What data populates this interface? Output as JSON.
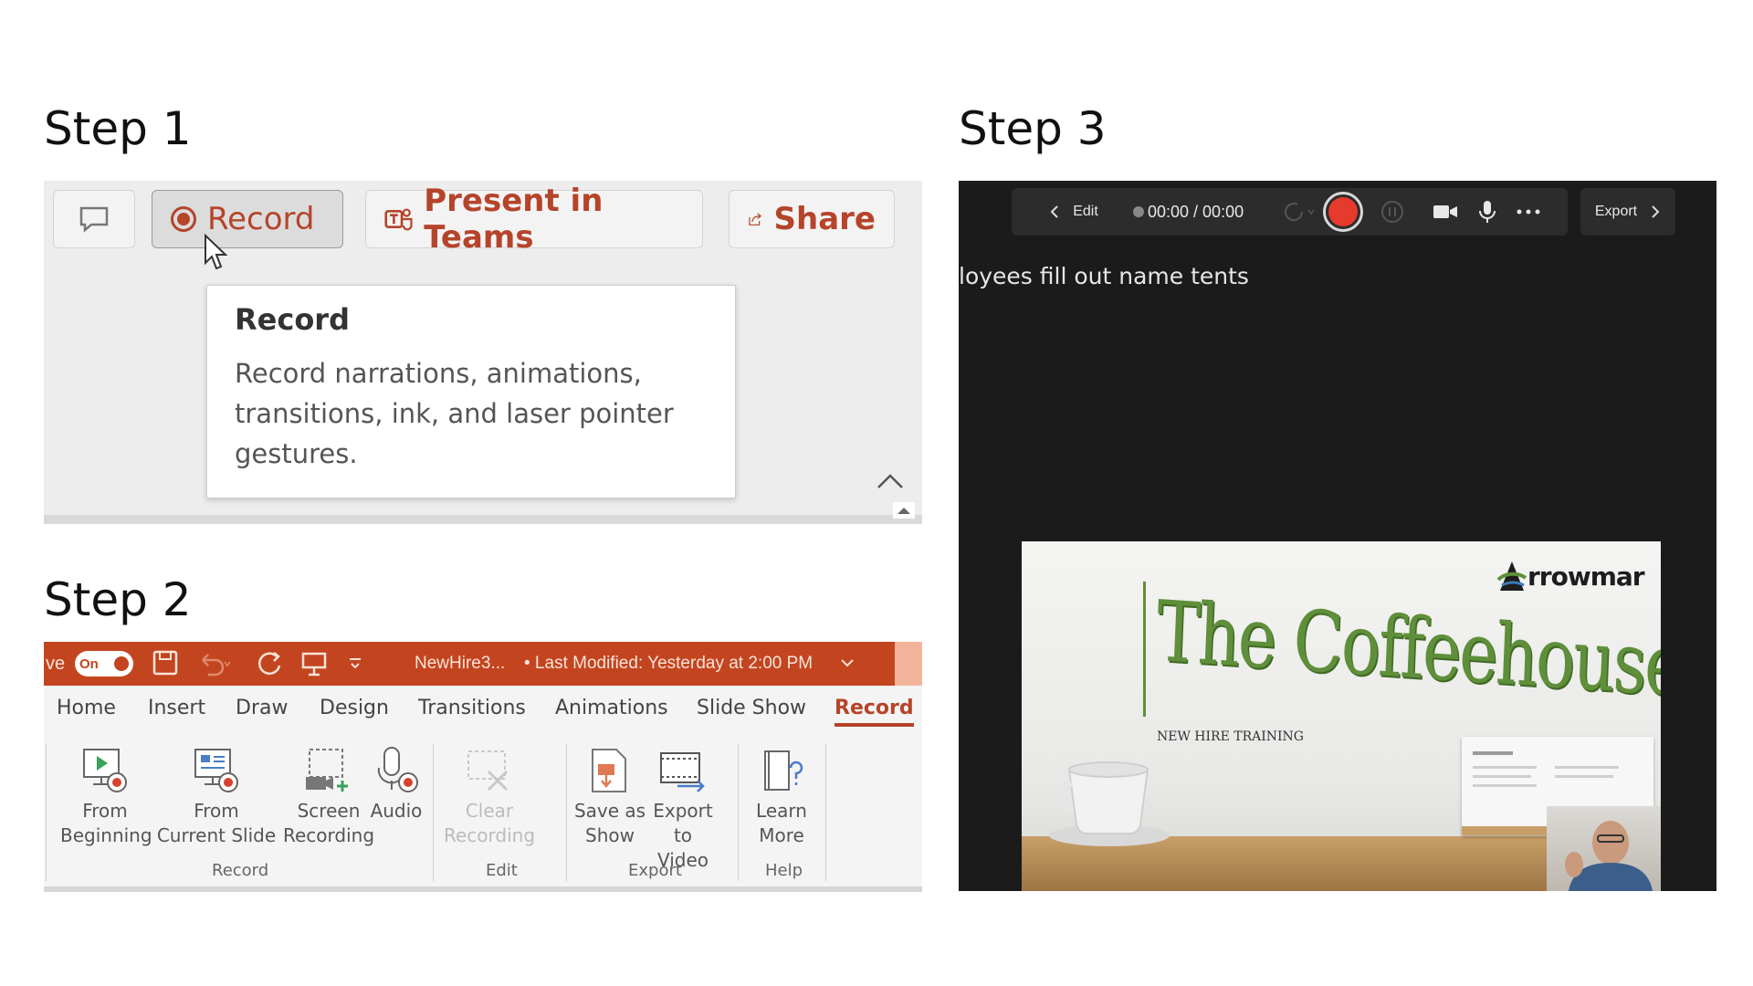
{
  "steps": {
    "step1": "Step 1",
    "step2": "Step 2",
    "step3": "Step 3"
  },
  "panel1": {
    "buttons": {
      "record": "Record",
      "present": "Present in Teams",
      "share": "Share"
    },
    "tooltip": {
      "title": "Record",
      "text": "Record narrations, animations, transitions, ink, and laser pointer gestures."
    }
  },
  "panel2": {
    "titlebar": {
      "autosave_fragment": "ve",
      "toggle": "On",
      "filename": "NewHire3...",
      "modified": "• Last Modified: Yesterday at 2:00 PM"
    },
    "tabs": [
      "Home",
      "Insert",
      "Draw",
      "Design",
      "Transitions",
      "Animations",
      "Slide Show",
      "Record"
    ],
    "buttons": {
      "from_beginning_1": "From",
      "from_beginning_2": "Beginning",
      "from_current_1": "From",
      "from_current_2": "Current Slide",
      "screen_rec_1": "Screen",
      "screen_rec_2": "Recording",
      "audio": "Audio",
      "clear_1": "Clear",
      "clear_2": "Recording",
      "save_show_1": "Save as",
      "save_show_2": "Show",
      "export_video_1": "Export",
      "export_video_2": "to Video",
      "learn_1": "Learn",
      "learn_2": "More"
    },
    "groups": {
      "record": "Record",
      "edit": "Edit",
      "export": "Export",
      "help": "Help"
    }
  },
  "panel3": {
    "edit": "Edit",
    "time": "00:00 / 00:00",
    "export": "Export",
    "overlay_text": "loyees fill out name tents",
    "slide": {
      "title": "The Coffeehouse",
      "subtitle": "NEW HIRE TRAINING",
      "logo": "rrowmar"
    }
  },
  "colors": {
    "accent": "#c3451f",
    "record_red": "#e53a2c",
    "dark_bg": "#1b1b1b",
    "slide_green": "#5f8f3a"
  }
}
